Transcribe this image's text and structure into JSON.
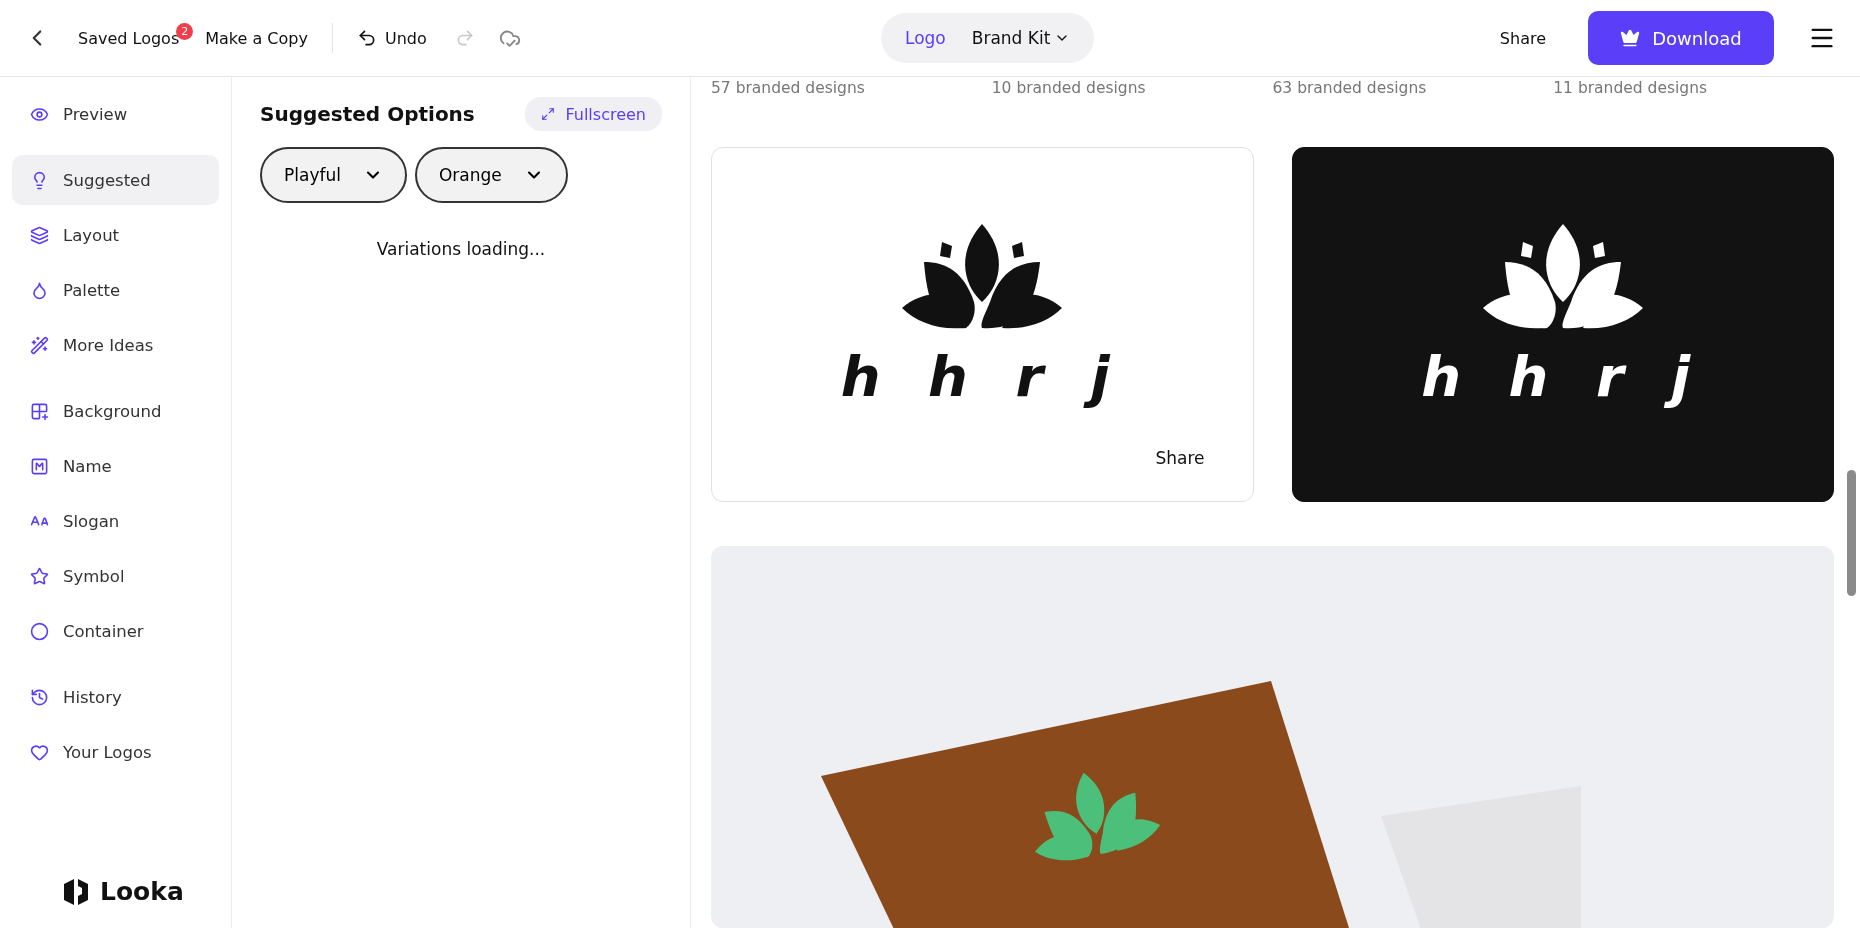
{
  "topbar": {
    "saved_logos": "Saved Logos",
    "saved_count": "2",
    "make_copy": "Make a Copy",
    "undo": "Undo",
    "redo_disabled": true,
    "tabs": [
      {
        "label": "Logo",
        "selected": true
      },
      {
        "label": "Brand Kit",
        "selected": false
      }
    ],
    "share": "Share",
    "download": "Download"
  },
  "sidebar": {
    "groups": [
      [
        {
          "label": "Preview",
          "selected": false
        }
      ],
      [
        {
          "label": "Suggested",
          "selected": true
        },
        {
          "label": "Layout",
          "selected": false
        },
        {
          "label": "Palette",
          "selected": false
        },
        {
          "label": "More Ideas",
          "selected": false
        }
      ],
      [
        {
          "label": "Background",
          "selected": false
        },
        {
          "label": "Name",
          "selected": false
        },
        {
          "label": "Slogan",
          "selected": false
        },
        {
          "label": "Symbol",
          "selected": false
        },
        {
          "label": "Container",
          "selected": false
        }
      ],
      [
        {
          "label": "History",
          "selected": false
        },
        {
          "label": "Your Logos",
          "selected": false
        }
      ]
    ],
    "brand": "Looka"
  },
  "options_panel": {
    "title": "Suggested Options",
    "fullscreen": "Fullscreen",
    "filters": [
      "Playful",
      "Orange"
    ],
    "status": "Variations loading..."
  },
  "content": {
    "design_counts": [
      "57 branded designs",
      "10 branded designs",
      "63 branded designs",
      "11 branded designs"
    ],
    "logo_cards": [
      {
        "dark": false,
        "wordmark": "h h r j",
        "share": "Share"
      },
      {
        "dark": true,
        "wordmark": "h h r j"
      }
    ]
  }
}
